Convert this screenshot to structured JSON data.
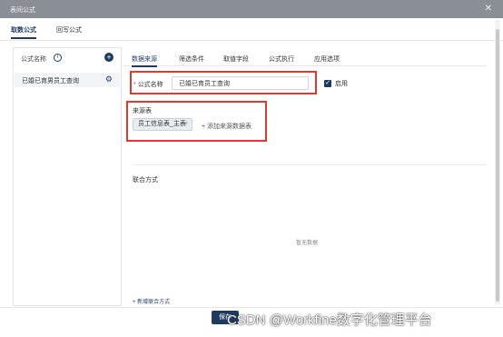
{
  "window": {
    "title": "表间公式",
    "close_icon": "close-icon"
  },
  "top_tabs": [
    {
      "label": "取数公式",
      "active": true
    },
    {
      "label": "回写公式",
      "active": false
    }
  ],
  "left_panel": {
    "header": "公式名称",
    "info_glyph": "i",
    "add_glyph": "+",
    "items": [
      {
        "label": "已婚已育男员工查询"
      }
    ]
  },
  "sub_tabs": [
    {
      "label": "数据来源",
      "active": true
    },
    {
      "label": "筛选条件",
      "active": false
    },
    {
      "label": "取值字段",
      "active": false
    },
    {
      "label": "公式执行",
      "active": false
    },
    {
      "label": "应用选项",
      "active": false
    }
  ],
  "form": {
    "required_mark": "*",
    "formula_name_label": "公式名称",
    "formula_name_value": "已婚已育员工查询",
    "enable_label": "启用",
    "enabled": true,
    "source_table_label": "来源表",
    "source_chip": "员工信息表_主表",
    "source_chip_close": "×",
    "add_source_link": "+ 添加来源数据表",
    "union_label": "联合方式",
    "empty_text": "暂无数据",
    "add_union_link": "+ 新增联合方式"
  },
  "footer": {
    "save_label": "保存"
  },
  "watermark": "CSDN @Workfine数字化管理平台"
}
